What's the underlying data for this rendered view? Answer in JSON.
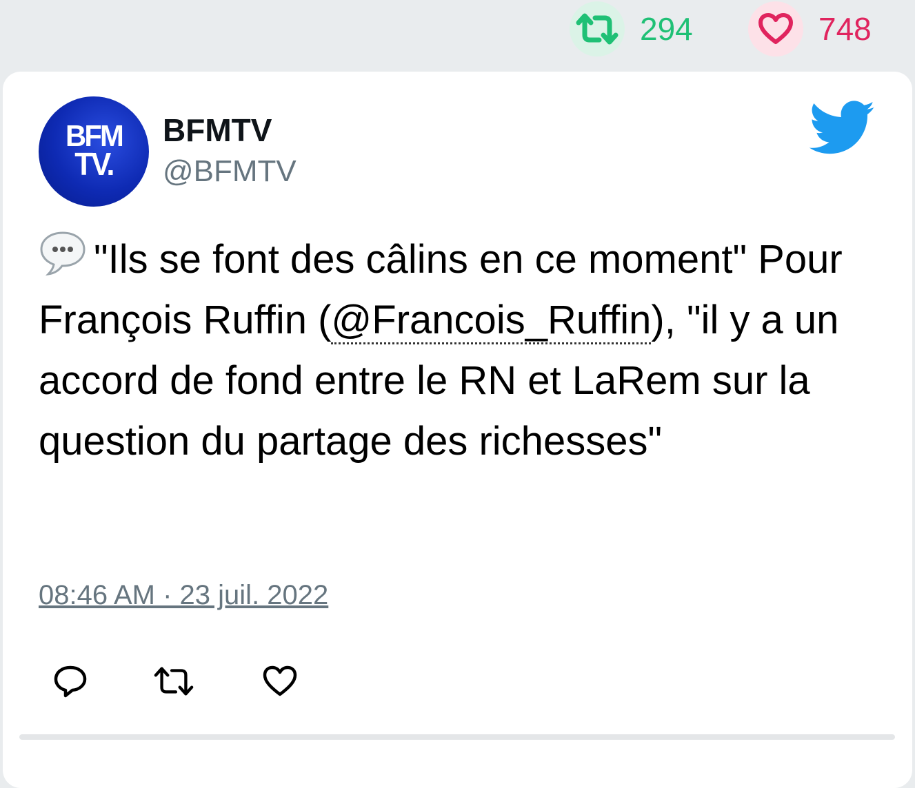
{
  "stats": {
    "retweets": "294",
    "likes": "748",
    "retweet_color": "#1fc075",
    "like_color": "#e0245e"
  },
  "tweet": {
    "author_name": "BFMTV",
    "author_handle": "@BFMTV",
    "avatar_text_line1": "BFM",
    "avatar_text_line2": "TV.",
    "emoji_icon": "speech-bubble-icon",
    "text_part1": "\"Ils se font des câlins en ce moment\" Pour François Ruffin (",
    "mention": "@Francois_Ruffin",
    "text_part2": "), \"il y a un accord de fond entre le RN et LaRem sur la question du partage des richesses\"",
    "timestamp": "08:46 AM · 23 juil. 2022",
    "brand_icon": "twitter-bird-icon"
  },
  "actions": [
    "reply-icon",
    "retweet-icon",
    "like-icon"
  ]
}
